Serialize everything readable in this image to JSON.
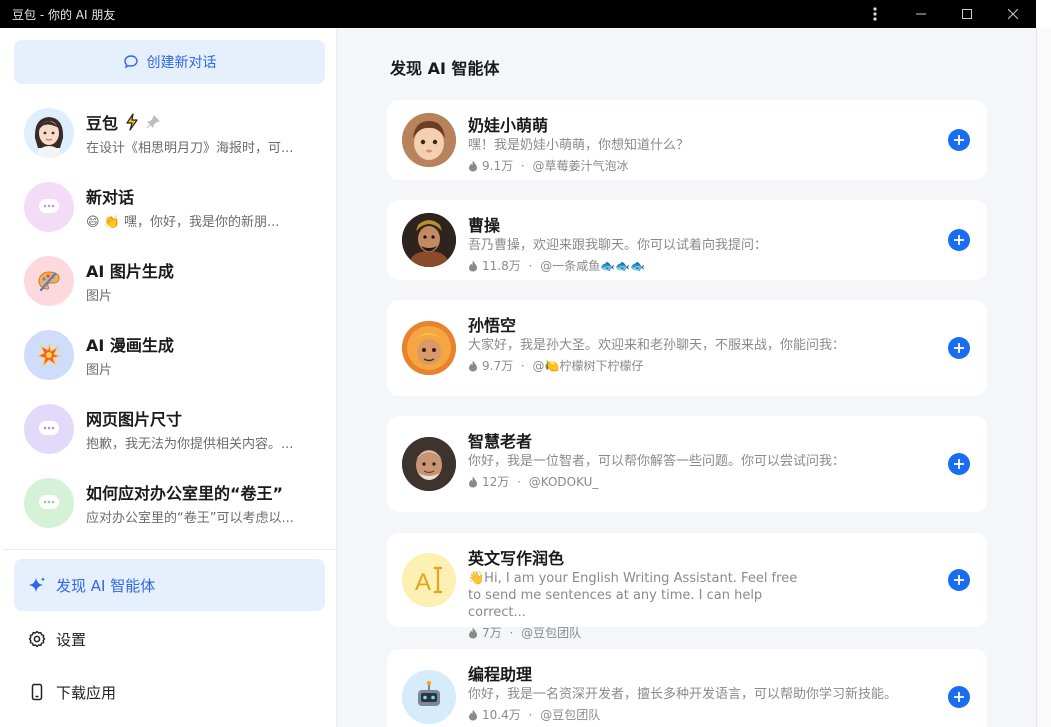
{
  "window": {
    "title": "豆包 - 你的 AI 朋友"
  },
  "sidebar": {
    "new_chat_label": "创建新对话",
    "conversations": [
      {
        "name": "豆包",
        "preview": "在设计《相思明月刀》海报时，可..."
      },
      {
        "name": "新对话",
        "preview": "😄 👏 嘿，你好，我是你的新朋..."
      },
      {
        "name": "AI 图片生成",
        "preview": "图片"
      },
      {
        "name": "AI 漫画生成",
        "preview": "图片"
      },
      {
        "name": "网页图片尺寸",
        "preview": "抱歉，我无法为你提供相关内容。..."
      },
      {
        "name": "如何应对办公室里的“卷王”",
        "preview": "应对办公室里的“卷王”可以考虑以..."
      }
    ],
    "menu": {
      "discover": "发现 AI 智能体",
      "settings": "设置",
      "download": "下载应用"
    }
  },
  "main": {
    "heading": "发现 AI 智能体",
    "agents": [
      {
        "name": "奶娃小萌萌",
        "desc": "嘿！我是奶娃小萌萌，你想知道什么？",
        "count": "9.1万",
        "author": "@草莓姜汁气泡冰"
      },
      {
        "name": "曹操",
        "desc": "吾乃曹操，欢迎来跟我聊天。你可以试着向我提问：",
        "count": "11.8万",
        "author": "@一条咸鱼🐟🐟🐟"
      },
      {
        "name": "孙悟空",
        "desc": "大家好，我是孙大圣。欢迎来和老孙聊天，不服来战，你能问我：",
        "count": "9.7万",
        "author": "@🍋柠檬树下柠檬仔"
      },
      {
        "name": "智慧老者",
        "desc": "你好，我是一位智者，可以帮你解答一些问题。你可以尝试问我：",
        "count": "12万",
        "author": "@KODOKU_"
      },
      {
        "name": "英文写作润色",
        "desc": "👋Hi, I am your English Writing Assistant. Feel free to send me sentences at any time. I can help correct...",
        "count": "7万",
        "author": "@豆包团队"
      },
      {
        "name": "编程助理",
        "desc": "你好，我是一名资深开发者，擅长多种开发语言，可以帮助你学习新技能。",
        "count": "10.4万",
        "author": "@豆包团队"
      }
    ]
  },
  "colors": {
    "accent": "#1a6cf0",
    "accent_light_bg": "#e6f0fd",
    "main_bg": "#f5f6f9"
  }
}
